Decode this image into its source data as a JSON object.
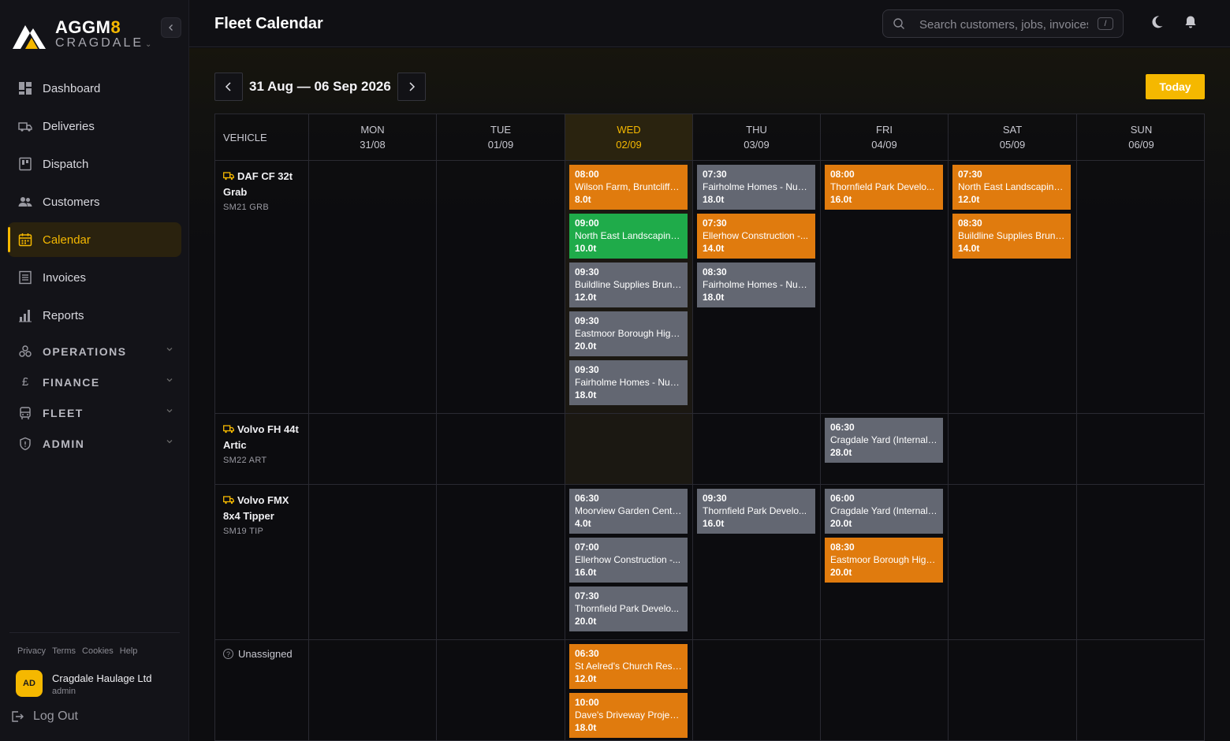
{
  "brand": {
    "name_main": "AGGM",
    "name_accent": "8",
    "sub": "CRAGDALE"
  },
  "sidebar": {
    "items": [
      {
        "label": "Dashboard",
        "icon": "dashboard-icon"
      },
      {
        "label": "Deliveries",
        "icon": "truck-icon"
      },
      {
        "label": "Dispatch",
        "icon": "dispatch-icon"
      },
      {
        "label": "Customers",
        "icon": "users-icon"
      },
      {
        "label": "Calendar",
        "icon": "calendar-icon",
        "active": true
      },
      {
        "label": "Invoices",
        "icon": "invoice-icon"
      },
      {
        "label": "Reports",
        "icon": "chart-icon"
      }
    ],
    "sections": [
      {
        "label": "OPERATIONS",
        "icon": "operations-icon"
      },
      {
        "label": "FINANCE",
        "icon": "pound-icon"
      },
      {
        "label": "FLEET",
        "icon": "fleet-icon"
      },
      {
        "label": "ADMIN",
        "icon": "shield-icon"
      }
    ],
    "footer_links": [
      "Privacy",
      "Terms",
      "Cookies",
      "Help"
    ],
    "user": {
      "initials": "AD",
      "company": "Cragdale Haulage Ltd",
      "role": "admin"
    },
    "logout_label": "Log Out"
  },
  "header": {
    "title": "Fleet Calendar",
    "search_placeholder": "Search customers, jobs, invoices...",
    "search_shortcut": "/"
  },
  "toolbar": {
    "range_label": "31 Aug — 06 Sep 2026",
    "today_label": "Today"
  },
  "calendar": {
    "vehicle_header": "VEHICLE",
    "days": [
      {
        "dow": "MON",
        "date": "31/08"
      },
      {
        "dow": "TUE",
        "date": "01/09"
      },
      {
        "dow": "WED",
        "date": "02/09",
        "today": true
      },
      {
        "dow": "THU",
        "date": "03/09"
      },
      {
        "dow": "FRI",
        "date": "04/09"
      },
      {
        "dow": "SAT",
        "date": "05/09"
      },
      {
        "dow": "SUN",
        "date": "06/09"
      }
    ],
    "vehicles": [
      {
        "name_line1": "DAF CF 32t",
        "name_line2": "Grab",
        "reg": "SM21 GRB"
      },
      {
        "name_line1": "Volvo FH 44t",
        "name_line2": "Artic",
        "reg": "SM22 ART"
      },
      {
        "name_line1": "Volvo FMX",
        "name_line2": "8x4 Tipper",
        "reg": "SM19 TIP"
      },
      {
        "name_line1": "Unassigned",
        "name_line2": "",
        "reg": ""
      }
    ],
    "colors": {
      "orange": "#e07b0e",
      "green": "#1fab4a",
      "grey": "#636772",
      "accent": "#f5b800"
    },
    "jobs": [
      {
        "row": 0,
        "day": 2,
        "slot": 0,
        "color": "orange",
        "time": "08:00",
        "desc": "Wilson Farm, Bruntcliffe...",
        "weight": "8.0t"
      },
      {
        "row": 0,
        "day": 2,
        "slot": 1,
        "color": "green",
        "time": "09:00",
        "desc": "North East Landscaping...",
        "weight": "10.0t"
      },
      {
        "row": 0,
        "day": 2,
        "slot": 2,
        "color": "grey",
        "time": "09:30",
        "desc": "Buildline Supplies Brunt...",
        "weight": "12.0t"
      },
      {
        "row": 0,
        "day": 2,
        "slot": 3,
        "color": "grey",
        "time": "09:30",
        "desc": "Eastmoor Borough High...",
        "weight": "20.0t"
      },
      {
        "row": 0,
        "day": 2,
        "slot": 4,
        "color": "grey",
        "time": "09:30",
        "desc": "Fairholme Homes - Nun...",
        "weight": "18.0t"
      },
      {
        "row": 0,
        "day": 3,
        "slot": 0,
        "color": "grey",
        "time": "07:30",
        "desc": "Fairholme Homes - Nun...",
        "weight": "18.0t"
      },
      {
        "row": 0,
        "day": 3,
        "slot": 1,
        "color": "orange",
        "time": "07:30",
        "desc": "Ellerhow Construction -...",
        "weight": "14.0t"
      },
      {
        "row": 0,
        "day": 3,
        "slot": 2,
        "color": "grey",
        "time": "08:30",
        "desc": "Fairholme Homes - Nun...",
        "weight": "18.0t"
      },
      {
        "row": 0,
        "day": 4,
        "slot": 0,
        "color": "orange",
        "time": "08:00",
        "desc": "Thornfield Park Develo...",
        "weight": "16.0t"
      },
      {
        "row": 0,
        "day": 5,
        "slot": 0,
        "color": "orange",
        "time": "07:30",
        "desc": "North East Landscaping...",
        "weight": "12.0t"
      },
      {
        "row": 0,
        "day": 5,
        "slot": 1,
        "color": "orange",
        "time": "08:30",
        "desc": "Buildline Supplies Brunt...",
        "weight": "14.0t"
      },
      {
        "row": 1,
        "day": 4,
        "slot": 0,
        "color": "grey",
        "time": "06:30",
        "desc": "Cragdale Yard (Internal) ...",
        "weight": "28.0t"
      },
      {
        "row": 2,
        "day": 2,
        "slot": 0,
        "color": "grey",
        "time": "06:30",
        "desc": "Moorview Garden Centr...",
        "weight": "4.0t"
      },
      {
        "row": 2,
        "day": 2,
        "slot": 1,
        "color": "grey",
        "time": "07:00",
        "desc": "Ellerhow Construction -...",
        "weight": "16.0t"
      },
      {
        "row": 2,
        "day": 2,
        "slot": 2,
        "color": "grey",
        "time": "07:30",
        "desc": "Thornfield Park Develo...",
        "weight": "20.0t"
      },
      {
        "row": 2,
        "day": 3,
        "slot": 0,
        "color": "grey",
        "time": "09:30",
        "desc": "Thornfield Park Develo...",
        "weight": "16.0t"
      },
      {
        "row": 2,
        "day": 4,
        "slot": 0,
        "color": "grey",
        "time": "06:00",
        "desc": "Cragdale Yard (Internal) ...",
        "weight": "20.0t"
      },
      {
        "row": 2,
        "day": 4,
        "slot": 1,
        "color": "orange",
        "time": "08:30",
        "desc": "Eastmoor Borough High...",
        "weight": "20.0t"
      },
      {
        "row": 3,
        "day": 2,
        "slot": 0,
        "color": "orange",
        "time": "06:30",
        "desc": "St Aelred's Church Rest...",
        "weight": "12.0t"
      },
      {
        "row": 3,
        "day": 2,
        "slot": 1,
        "color": "orange",
        "time": "10:00",
        "desc": "Dave's Driveway Project...",
        "weight": "18.0t"
      }
    ]
  }
}
